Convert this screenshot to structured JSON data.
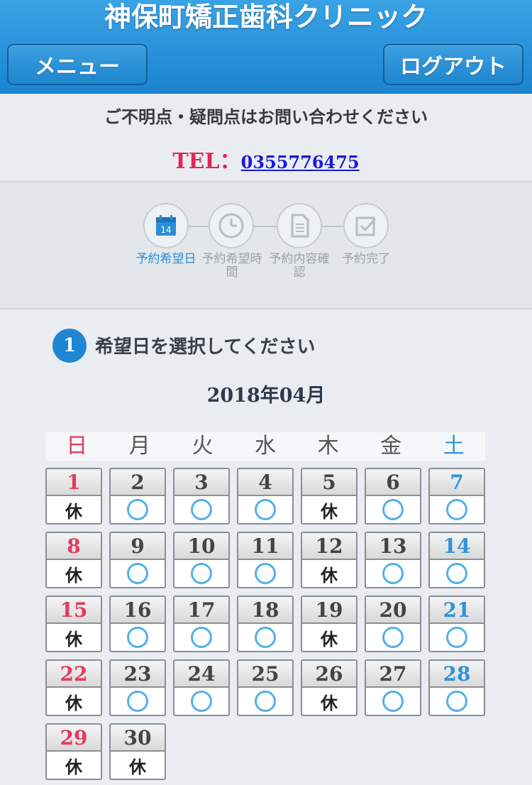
{
  "header": {
    "title": "神保町矯正歯科クリニック",
    "menu_label": "メニュー",
    "logout_label": "ログアウト"
  },
  "contact": {
    "message": "ご不明点・疑問点はお問い合わせください",
    "tel_label": "TEL：",
    "tel_number": "0355776475"
  },
  "steps": [
    {
      "label": "予約希望日",
      "icon": "calendar-icon",
      "active": true
    },
    {
      "label": "予約希望時間",
      "icon": "clock-icon",
      "active": false
    },
    {
      "label": "予約内容確認",
      "icon": "document-icon",
      "active": false
    },
    {
      "label": "予約完了",
      "icon": "checkbox-icon",
      "active": false
    }
  ],
  "section": {
    "number": "1",
    "title": "希望日を選択してください"
  },
  "calendar": {
    "month_label": "2018年04月",
    "weekdays": [
      "日",
      "月",
      "火",
      "水",
      "木",
      "金",
      "土"
    ],
    "closed_label": "休",
    "available_mark": "circle",
    "colors": {
      "sunday": "#e23b5c",
      "saturday": "#2f93d8",
      "accent": "#1f86d4"
    },
    "weeks": [
      [
        {
          "d": "1",
          "s": "closed"
        },
        {
          "d": "2",
          "s": "open"
        },
        {
          "d": "3",
          "s": "open"
        },
        {
          "d": "4",
          "s": "open"
        },
        {
          "d": "5",
          "s": "closed"
        },
        {
          "d": "6",
          "s": "open"
        },
        {
          "d": "7",
          "s": "open"
        }
      ],
      [
        {
          "d": "8",
          "s": "closed"
        },
        {
          "d": "9",
          "s": "open"
        },
        {
          "d": "10",
          "s": "open"
        },
        {
          "d": "11",
          "s": "open"
        },
        {
          "d": "12",
          "s": "closed"
        },
        {
          "d": "13",
          "s": "open"
        },
        {
          "d": "14",
          "s": "open"
        }
      ],
      [
        {
          "d": "15",
          "s": "closed"
        },
        {
          "d": "16",
          "s": "open"
        },
        {
          "d": "17",
          "s": "open"
        },
        {
          "d": "18",
          "s": "open"
        },
        {
          "d": "19",
          "s": "closed"
        },
        {
          "d": "20",
          "s": "open"
        },
        {
          "d": "21",
          "s": "open"
        }
      ],
      [
        {
          "d": "22",
          "s": "closed"
        },
        {
          "d": "23",
          "s": "open"
        },
        {
          "d": "24",
          "s": "open"
        },
        {
          "d": "25",
          "s": "open"
        },
        {
          "d": "26",
          "s": "closed"
        },
        {
          "d": "27",
          "s": "open"
        },
        {
          "d": "28",
          "s": "open"
        }
      ],
      [
        {
          "d": "29",
          "s": "closed"
        },
        {
          "d": "30",
          "s": "closed"
        }
      ]
    ]
  }
}
